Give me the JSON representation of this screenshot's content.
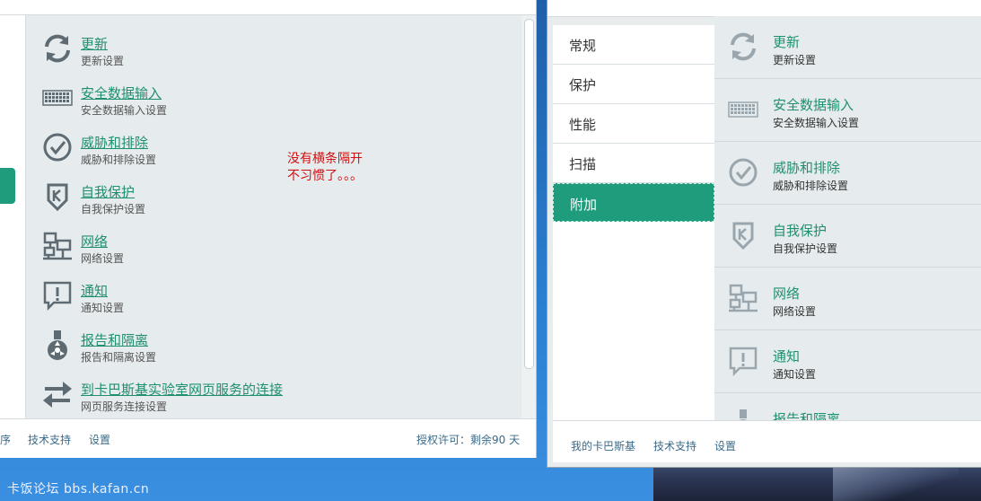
{
  "watermark": "卡饭论坛 bbs.kafan.cn",
  "annotation": {
    "line1": "没有横条隔开",
    "line2": "不习惯了。。。"
  },
  "left_window": {
    "items": [
      {
        "title": "更新",
        "subtitle": "更新设置",
        "icon": "refresh-icon"
      },
      {
        "title": "安全数据输入",
        "subtitle": "安全数据输入设置",
        "icon": "keyboard-icon"
      },
      {
        "title": "威胁和排除",
        "subtitle": "威胁和排除设置",
        "icon": "check-circle-icon"
      },
      {
        "title": "自我保护",
        "subtitle": "自我保护设置",
        "icon": "shield-k-icon"
      },
      {
        "title": "网络",
        "subtitle": "网络设置",
        "icon": "network-icon"
      },
      {
        "title": "通知",
        "subtitle": "通知设置",
        "icon": "alert-icon"
      },
      {
        "title": "报告和隔离",
        "subtitle": "报告和隔离设置",
        "icon": "flask-icon"
      },
      {
        "title": "到卡巴斯基实验室网页服务的连接",
        "subtitle": "网页服务连接设置",
        "icon": "transfer-icon"
      }
    ],
    "footer": {
      "partial": "序",
      "support": "技术支持",
      "settings": "设置",
      "license": "授权许可：剩余90 天"
    }
  },
  "right_window": {
    "nav": [
      {
        "label": "常规",
        "active": false
      },
      {
        "label": "保护",
        "active": false
      },
      {
        "label": "性能",
        "active": false
      },
      {
        "label": "扫描",
        "active": false
      },
      {
        "label": "附加",
        "active": true
      }
    ],
    "items": [
      {
        "title": "更新",
        "subtitle": "更新设置",
        "icon": "refresh-icon"
      },
      {
        "title": "安全数据输入",
        "subtitle": "安全数据输入设置",
        "icon": "keyboard-icon"
      },
      {
        "title": "威胁和排除",
        "subtitle": "威胁和排除设置",
        "icon": "check-circle-icon"
      },
      {
        "title": "自我保护",
        "subtitle": "自我保护设置",
        "icon": "shield-k-icon"
      },
      {
        "title": "网络",
        "subtitle": "网络设置",
        "icon": "network-icon"
      },
      {
        "title": "通知",
        "subtitle": "通知设置",
        "icon": "alert-icon"
      },
      {
        "title": "报告和隔离",
        "subtitle": "",
        "icon": "flask-icon"
      }
    ],
    "footer": {
      "my_kaspersky": "我的卡巴斯基",
      "support": "技术支持",
      "settings": "设置"
    }
  },
  "colors": {
    "accent": "#1e9c7c",
    "link": "#1f8f6f",
    "annotation": "#d01010",
    "icon": "#5f6b73"
  }
}
